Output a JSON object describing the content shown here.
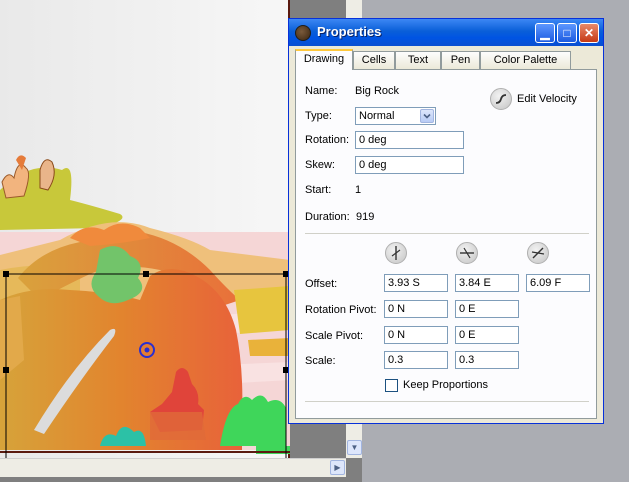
{
  "window": {
    "title": "Properties",
    "buttons": {
      "minimize": "▁",
      "maximize": "□",
      "close": "✕"
    }
  },
  "tabs": [
    "Drawing",
    "Cells",
    "Text",
    "Pen",
    "Color Palette"
  ],
  "active_tab": "Drawing",
  "drawing": {
    "name_label": "Name:",
    "name_value": "Big Rock",
    "type_label": "Type:",
    "type_value": "Normal",
    "rotation_label": "Rotation:",
    "rotation_value": "0 deg",
    "skew_label": "Skew:",
    "skew_value": "0 deg",
    "start_label": "Start:",
    "start_value": "1",
    "duration_label": "Duration:",
    "duration_value": "919",
    "edit_velocity_label": "Edit Velocity",
    "offset_label": "Offset:",
    "offset_values": [
      "3.93 S",
      "3.84 E",
      "6.09 F"
    ],
    "rotation_pivot_label": "Rotation Pivot:",
    "rotation_pivot_values": [
      "0 N",
      "0 E"
    ],
    "scale_pivot_label": "Scale Pivot:",
    "scale_pivot_values": [
      "0 N",
      "0 E"
    ],
    "scale_label": "Scale:",
    "scale_values": [
      "0.3",
      "0.3"
    ],
    "keep_proportions_label": "Keep Proportions",
    "keep_proportions_checked": false
  },
  "icons": {
    "window": "app-icon",
    "velocity": "velocity-curve-icon",
    "axis": [
      "axis-ns-icon",
      "axis-ew-icon",
      "axis-fb-icon"
    ],
    "scroll_down": "chevron-down-icon"
  },
  "colors": {
    "titlebar": "#0054e3",
    "tab_highlight": "#ffc83c",
    "panel": "#fcfcfe",
    "pivot": "#2a2fd0"
  }
}
